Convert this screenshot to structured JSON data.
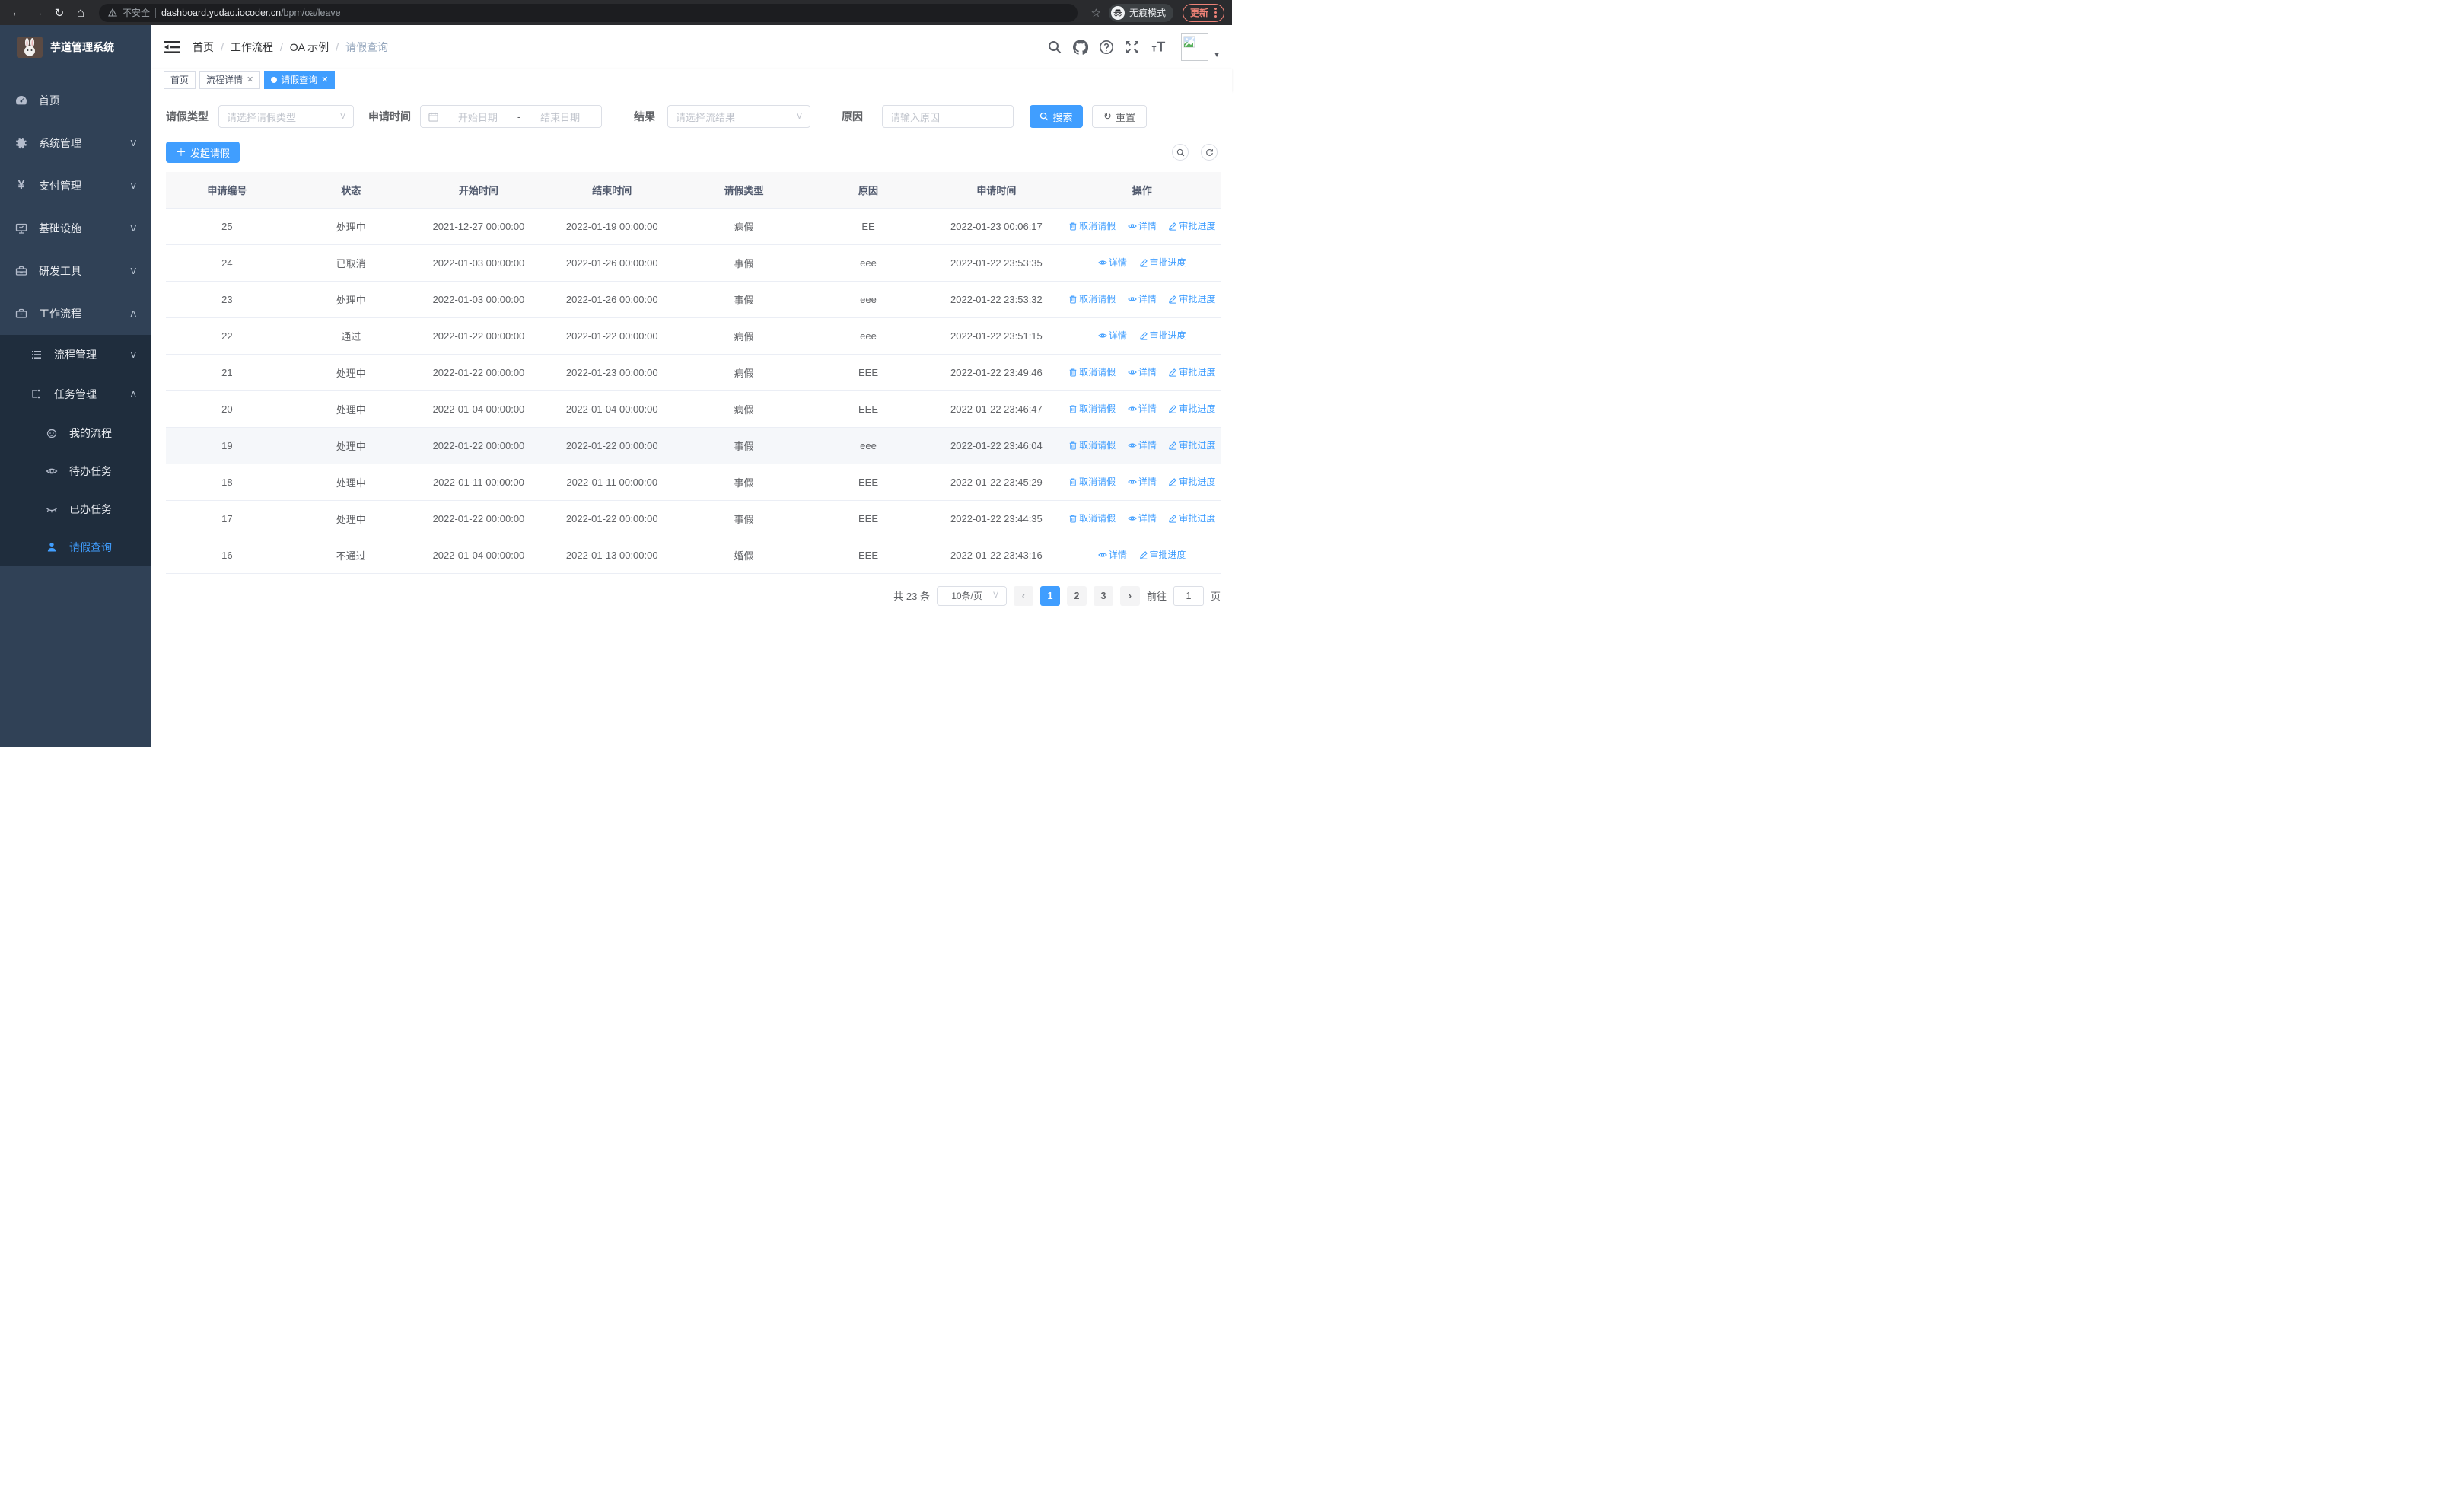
{
  "colors": {
    "accent": "#409eff",
    "sidebar_bg": "#304156",
    "submenu_bg": "#1f2d3d",
    "update_red": "#ee8277"
  },
  "browser": {
    "security_label": "不安全",
    "url_host": "dashboard.yudao.iocoder.cn",
    "url_path": "/bpm/oa/leave",
    "incognito_label": "无痕模式",
    "update_label": "更新"
  },
  "sidebar": {
    "app_title": "芋道管理系统",
    "items": [
      {
        "label": "首页",
        "icon": "dashboard-icon"
      },
      {
        "label": "系统管理",
        "icon": "gear-icon"
      },
      {
        "label": "支付管理",
        "icon": "yen-icon"
      },
      {
        "label": "基础设施",
        "icon": "monitor-icon"
      },
      {
        "label": "研发工具",
        "icon": "toolbox-icon"
      },
      {
        "label": "工作流程",
        "icon": "briefcase-icon"
      },
      {
        "label": "流程管理",
        "icon": "list-icon"
      },
      {
        "label": "任务管理",
        "icon": "tree-icon"
      },
      {
        "label": "我的流程",
        "icon": "robot-icon"
      },
      {
        "label": "待办任务",
        "icon": "eye-icon"
      },
      {
        "label": "已办任务",
        "icon": "eye-off-icon"
      },
      {
        "label": "请假查询",
        "icon": "user-icon"
      }
    ]
  },
  "breadcrumb": {
    "items": [
      "首页",
      "工作流程",
      "OA 示例",
      "请假查询"
    ]
  },
  "tabs": [
    {
      "label": "首页"
    },
    {
      "label": "流程详情"
    },
    {
      "label": "请假查询"
    }
  ],
  "filters": {
    "leave_type_label": "请假类型",
    "leave_type_placeholder": "请选择请假类型",
    "apply_time_label": "申请时间",
    "start_date_placeholder": "开始日期",
    "range_separator": "-",
    "end_date_placeholder": "结束日期",
    "result_label": "结果",
    "result_placeholder": "请选择流结果",
    "reason_label": "原因",
    "reason_placeholder": "请输入原因",
    "search_label": "搜索",
    "reset_label": "重置"
  },
  "toolbar": {
    "create_label": "发起请假"
  },
  "actions": {
    "cancel_label": "取消请假",
    "detail_label": "详情",
    "progress_label": "审批进度"
  },
  "table": {
    "columns": [
      "申请编号",
      "状态",
      "开始时间",
      "结束时间",
      "请假类型",
      "原因",
      "申请时间",
      "操作"
    ],
    "rows": [
      {
        "id": "25",
        "status": "处理中",
        "start": "2021-12-27 00:00:00",
        "end": "2022-01-19 00:00:00",
        "type": "病假",
        "reason": "EE",
        "applied": "2022-01-23 00:06:17",
        "cancelable": true,
        "highlighted": false
      },
      {
        "id": "24",
        "status": "已取消",
        "start": "2022-01-03 00:00:00",
        "end": "2022-01-26 00:00:00",
        "type": "事假",
        "reason": "eee",
        "applied": "2022-01-22 23:53:35",
        "cancelable": false,
        "highlighted": false
      },
      {
        "id": "23",
        "status": "处理中",
        "start": "2022-01-03 00:00:00",
        "end": "2022-01-26 00:00:00",
        "type": "事假",
        "reason": "eee",
        "applied": "2022-01-22 23:53:32",
        "cancelable": true,
        "highlighted": false
      },
      {
        "id": "22",
        "status": "通过",
        "start": "2022-01-22 00:00:00",
        "end": "2022-01-22 00:00:00",
        "type": "病假",
        "reason": "eee",
        "applied": "2022-01-22 23:51:15",
        "cancelable": false,
        "highlighted": false
      },
      {
        "id": "21",
        "status": "处理中",
        "start": "2022-01-22 00:00:00",
        "end": "2022-01-23 00:00:00",
        "type": "病假",
        "reason": "EEE",
        "applied": "2022-01-22 23:49:46",
        "cancelable": true,
        "highlighted": false
      },
      {
        "id": "20",
        "status": "处理中",
        "start": "2022-01-04 00:00:00",
        "end": "2022-01-04 00:00:00",
        "type": "病假",
        "reason": "EEE",
        "applied": "2022-01-22 23:46:47",
        "cancelable": true,
        "highlighted": false
      },
      {
        "id": "19",
        "status": "处理中",
        "start": "2022-01-22 00:00:00",
        "end": "2022-01-22 00:00:00",
        "type": "事假",
        "reason": "eee",
        "applied": "2022-01-22 23:46:04",
        "cancelable": true,
        "highlighted": true
      },
      {
        "id": "18",
        "status": "处理中",
        "start": "2022-01-11 00:00:00",
        "end": "2022-01-11 00:00:00",
        "type": "事假",
        "reason": "EEE",
        "applied": "2022-01-22 23:45:29",
        "cancelable": true,
        "highlighted": false
      },
      {
        "id": "17",
        "status": "处理中",
        "start": "2022-01-22 00:00:00",
        "end": "2022-01-22 00:00:00",
        "type": "事假",
        "reason": "EEE",
        "applied": "2022-01-22 23:44:35",
        "cancelable": true,
        "highlighted": false
      },
      {
        "id": "16",
        "status": "不通过",
        "start": "2022-01-04 00:00:00",
        "end": "2022-01-13 00:00:00",
        "type": "婚假",
        "reason": "EEE",
        "applied": "2022-01-22 23:43:16",
        "cancelable": false,
        "highlighted": false
      }
    ]
  },
  "pagination": {
    "total_text": "共 23 条",
    "page_size_text": "10条/页",
    "pages": [
      "1",
      "2",
      "3"
    ],
    "current_page": "1",
    "goto_prefix": "前往",
    "goto_value": "1",
    "goto_suffix": "页"
  }
}
